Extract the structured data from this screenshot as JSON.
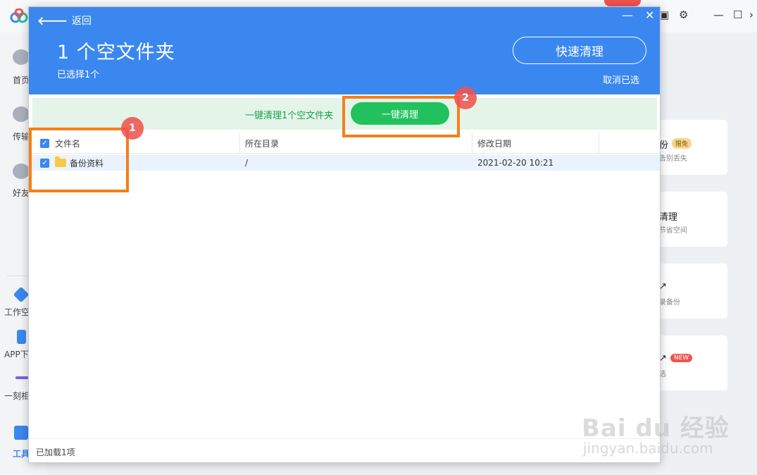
{
  "background": {
    "nav": [
      {
        "label": "首页"
      },
      {
        "label": "传输"
      },
      {
        "label": "好友"
      },
      {
        "label": "工作空"
      },
      {
        "label": "APP下"
      },
      {
        "label": "一刻相"
      },
      {
        "label": "工具"
      }
    ],
    "cards": [
      {
        "title": "份",
        "subtitle": "告别丢失",
        "tag": "限免"
      },
      {
        "title": "清理",
        "subtitle": "节省空间"
      },
      {
        "title": "↗",
        "subtitle": "录备份"
      },
      {
        "title": "↗",
        "subtitle": "选",
        "tag": "NEW"
      }
    ]
  },
  "dialog": {
    "back_label": "返回",
    "title": "1 个空文件夹",
    "subtitle": "已选择1个",
    "quick_clean_label": "快速清理",
    "cancel_selection_label": "取消已选",
    "banner": {
      "message": "一键清理1个空文件夹",
      "button_label": "一键清理"
    },
    "table": {
      "columns": [
        "文件名",
        "所在目录",
        "修改日期"
      ],
      "rows": [
        {
          "name": "备份资料",
          "dir": "/",
          "modified": "2021-02-20 10:21",
          "checked": true
        }
      ]
    },
    "footer": "已加载1项"
  },
  "annotations": [
    "1",
    "2"
  ],
  "watermark": {
    "logo": "Bai du 经验",
    "url": "jingyan.baidu.com"
  },
  "colors": {
    "header_blue": "#3b87f0",
    "green_button": "#21c25e",
    "annotation_orange": "#f57f17",
    "annotation_badge": "#ef5350"
  }
}
